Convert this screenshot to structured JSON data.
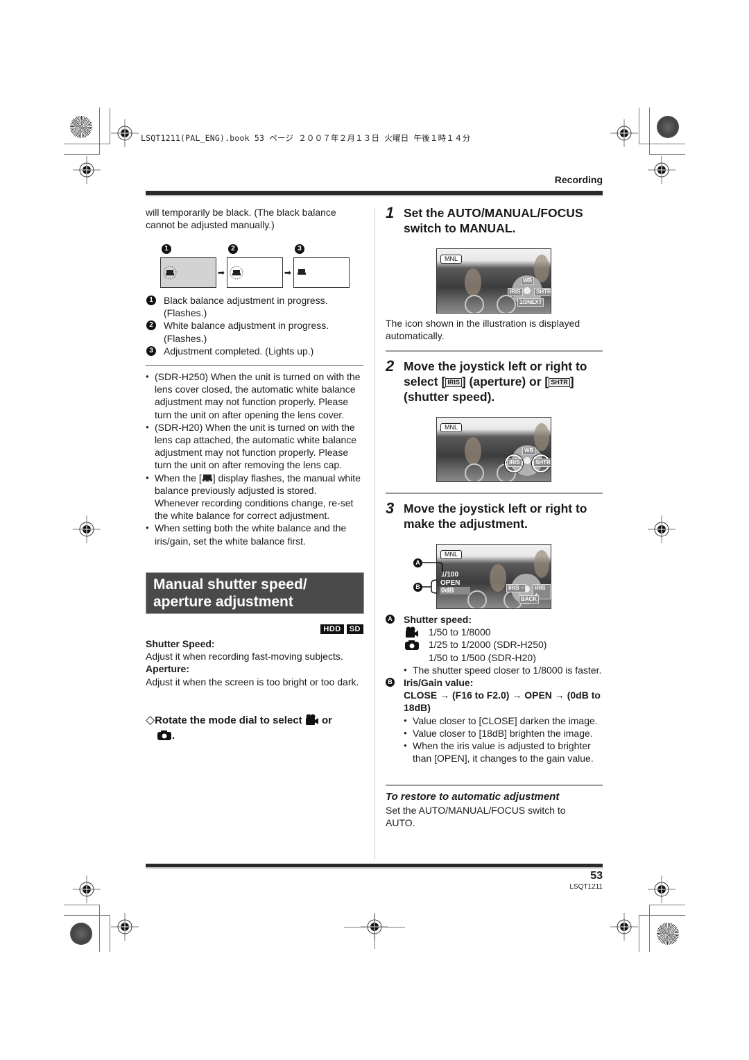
{
  "print_header": {
    "file_info": "LSQT1211(PAL_ENG).book  53 ページ  ２００７年２月１３日  火曜日  午後１時１４分"
  },
  "section_label": "Recording",
  "left_column": {
    "intro_text": "will temporarily be black. (The black balance cannot be adjusted manually.)",
    "diagram": {
      "steps": [
        {
          "num": "1",
          "state": "black-balance-in-progress"
        },
        {
          "num": "2",
          "state": "white-balance-in-progress"
        },
        {
          "num": "3",
          "state": "completed"
        }
      ]
    },
    "legend": [
      {
        "num": "1",
        "text": "Black balance adjustment in progress. (Flashes.)"
      },
      {
        "num": "2",
        "text": "White balance adjustment in progress. (Flashes.)"
      },
      {
        "num": "3",
        "text": "Adjustment completed. (Lights up.)"
      }
    ],
    "notes": [
      "(SDR-H250) When the unit is turned on with the lens cover closed, the automatic white balance adjustment may not function properly. Please turn the unit on after opening the lens cover.",
      "(SDR-H20) When the unit is turned on with the lens cap attached, the automatic white balance adjustment may not function properly. Please turn the unit on after removing the lens cap.",
      "When setting both the white balance and the iris/gain, set the white balance first."
    ],
    "note_wb_prefix": "When the [",
    "note_wb_suffix": "] display flashes, the manual white balance previously adjusted is stored. Whenever recording conditions change, re-set the white balance for correct adjustment.",
    "section_title_line1": "Manual shutter speed/",
    "section_title_line2": "aperture adjustment",
    "media_badges": [
      "HDD",
      "SD"
    ],
    "shutter_speed_heading": "Shutter Speed:",
    "shutter_speed_text": "Adjust it when recording fast-moving subjects.",
    "aperture_heading": "Aperture:",
    "aperture_text": "Adjust it when the screen is too bright or too dark.",
    "mode_dial_instruction_prefix": "Rotate the mode dial to select",
    "mode_dial_instruction_or": "or",
    "mode_dial_instruction_end": "."
  },
  "right_column": {
    "steps": [
      {
        "number": "1",
        "text": "Set the AUTO/MANUAL/FOCUS switch to MANUAL."
      },
      {
        "number": "2",
        "text_prefix": "Move the joystick left or right to select [",
        "icon1": "IRIS",
        "text_mid": "] (aperture) or [",
        "icon2": "SHTR",
        "text_suffix": "] (shutter speed)."
      },
      {
        "number": "3",
        "text": "Move the joystick left or right to make the adjustment."
      }
    ],
    "step1_caption": "The icon shown in the illustration is displayed automatically.",
    "screen_osd": {
      "mnl": "MNL",
      "wb": "WB",
      "iris": "IRIS",
      "shtr": "SHTR",
      "next": "1/3NEXT",
      "shutter_value": "1/100",
      "iris_value": "OPEN",
      "gain_value": "0dB",
      "iris_minus": "IRIS −",
      "iris_plus": "IRIS +",
      "back": "BACK"
    },
    "callouts": {
      "a": "A",
      "b": "B"
    },
    "shutter_speed": {
      "label": "A",
      "heading": "Shutter speed:",
      "video_range": "1/50 to 1/8000",
      "photo_range_h250": "1/25 to 1/2000 (SDR-H250)",
      "photo_range_h20": "1/50 to 1/500 (SDR-H20)",
      "note": "The shutter speed closer to 1/8000 is faster."
    },
    "iris_gain": {
      "label": "B",
      "heading": "Iris/Gain value:",
      "sequence": "CLOSE → (F16 to F2.0) → OPEN → (0dB to 18dB)",
      "notes": [
        "Value closer to [CLOSE] darken the image.",
        "Value closer to [18dB] brighten the image.",
        "When the iris value is adjusted to brighter than [OPEN], it changes to the gain value."
      ]
    },
    "restore_heading": "To restore to automatic adjustment",
    "restore_text": "Set the AUTO/MANUAL/FOCUS switch to AUTO."
  },
  "footer": {
    "page_number": "53",
    "doc_code": "LSQT1211"
  }
}
